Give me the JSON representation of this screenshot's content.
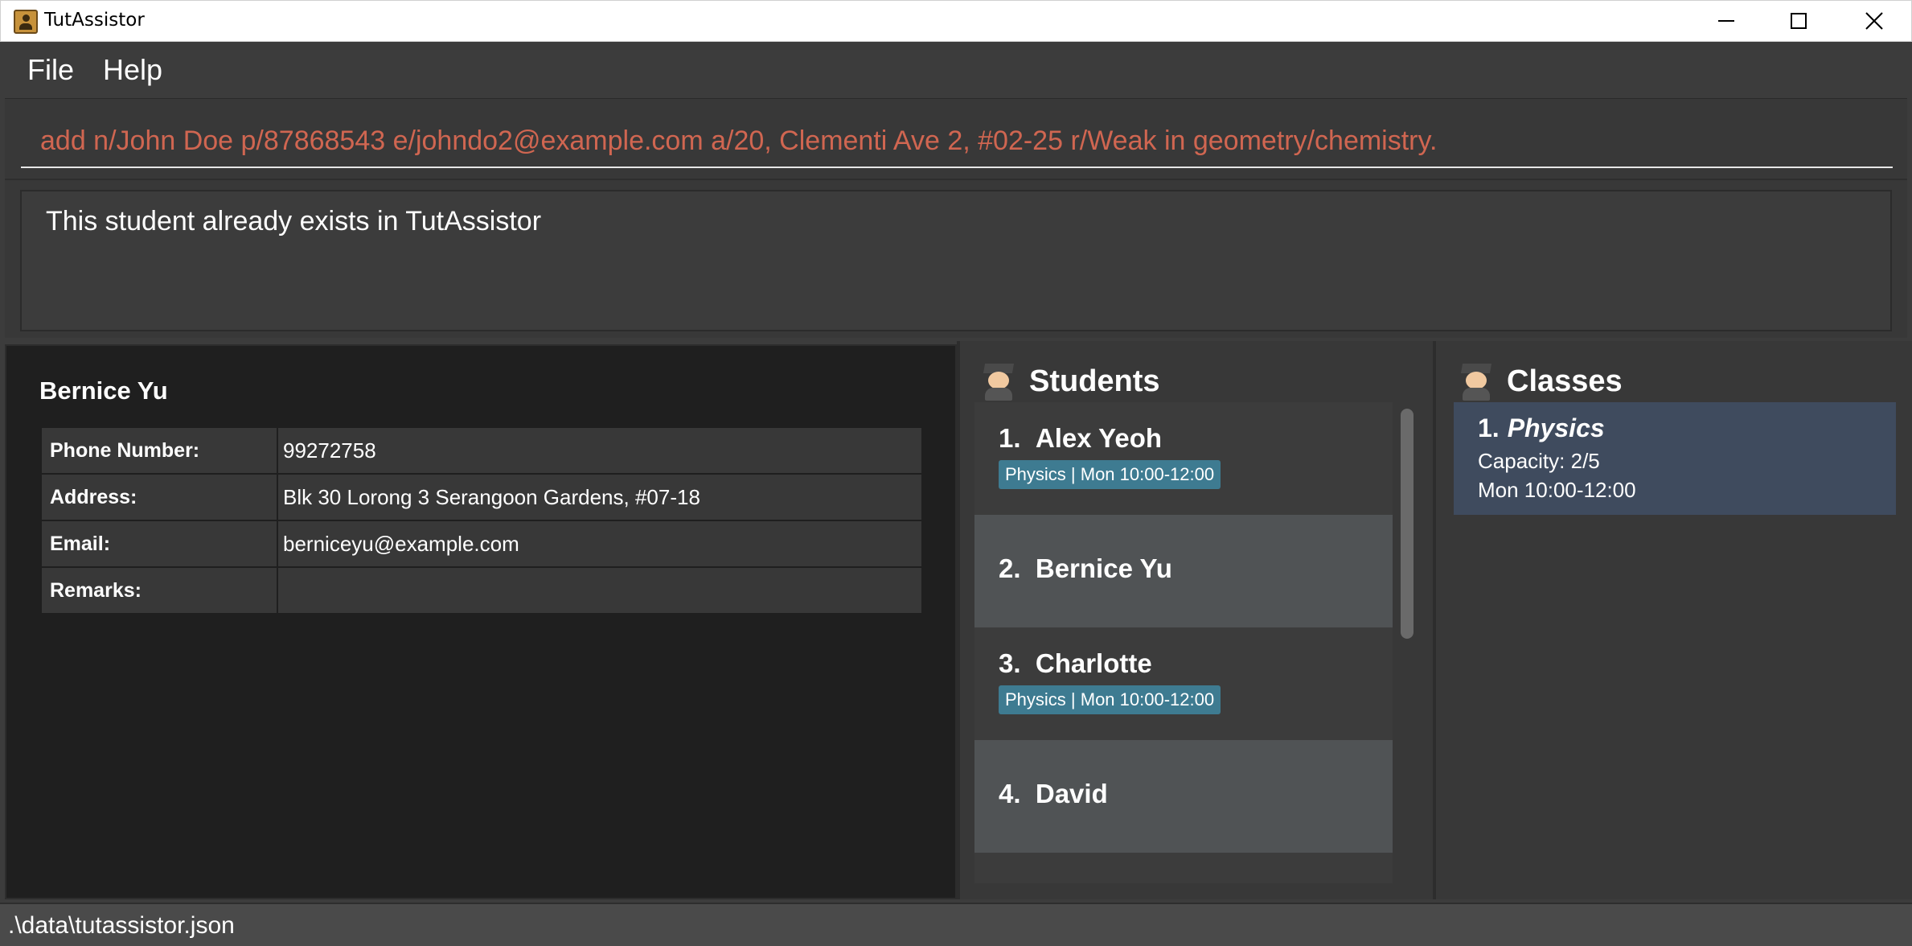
{
  "window": {
    "title": "TutAssistor",
    "app_icon": "contact-book-icon",
    "controls": [
      "minimize-icon",
      "maximize-icon",
      "close-icon"
    ]
  },
  "menu": {
    "file": "File",
    "help": "Help"
  },
  "command": {
    "value": "add n/John Doe p/87868543 e/johndo2@example.com a/20, Clementi Ave 2, #02-25 r/Weak in geometry/chemistry.",
    "text_color": "#d06651"
  },
  "result": {
    "message": "This student already exists in TutAssistor"
  },
  "detail": {
    "name": "Bernice Yu",
    "rows": [
      {
        "label": "Phone Number:",
        "value": "99272758"
      },
      {
        "label": "Address:",
        "value": "Blk 30 Lorong 3 Serangoon Gardens, #07-18"
      },
      {
        "label": "Email:",
        "value": "berniceyu@example.com"
      },
      {
        "label": "Remarks:",
        "value": ""
      }
    ]
  },
  "students": {
    "title": "Students",
    "icon": "student-icon",
    "items": [
      {
        "index": "1.",
        "name": "Alex Yeoh",
        "tag": "Physics | Mon 10:00-12:00"
      },
      {
        "index": "2.",
        "name": "Bernice Yu",
        "tag": ""
      },
      {
        "index": "3.",
        "name": "Charlotte",
        "tag": "Physics | Mon 10:00-12:00"
      },
      {
        "index": "4.",
        "name": "David",
        "tag": ""
      }
    ]
  },
  "classes": {
    "title": "Classes",
    "icon": "student-icon",
    "items": [
      {
        "index": "1.",
        "subject": "Physics",
        "capacity": "Capacity: 2/5",
        "time": "Mon 10:00-12:00"
      }
    ]
  },
  "status": {
    "path": ".\\data\\tutassistor.json"
  },
  "colors": {
    "tag_background": "#3e7b91",
    "selected_class_background": "#3f4b5e"
  }
}
